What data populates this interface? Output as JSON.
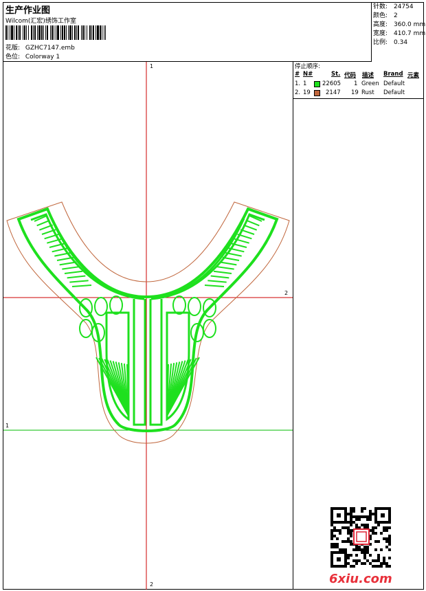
{
  "header": {
    "title": "生产作业图",
    "company": "Wilcom(汇宏)绣饰工作室",
    "design_label": "花版:",
    "design_value": "GZHC7147.emb",
    "colorway_label": "色位:",
    "colorway_value": "Colorway 1"
  },
  "stats": [
    {
      "label": "针数:",
      "value": "24754"
    },
    {
      "label": "颜色:",
      "value": "2"
    },
    {
      "label": "高度:",
      "value": "360.0 mm"
    },
    {
      "label": "宽度:",
      "value": "410.7 mm"
    },
    {
      "label": "比例:",
      "value": "0.34"
    }
  ],
  "color_sequence": {
    "title": "停止顺序:",
    "columns": [
      "#",
      "N#",
      "St.",
      "代码",
      "描述",
      "Brand",
      "元素"
    ],
    "rows": [
      {
        "index": "1.",
        "n": "1",
        "color": "#1ee01e",
        "stitches": "22605",
        "code": "1",
        "description": "Green",
        "brand": "Default"
      },
      {
        "index": "2.",
        "n": "19",
        "color": "#c0663c",
        "stitches": "2147",
        "code": "19",
        "description": "Rust",
        "brand": "Default"
      }
    ]
  },
  "axes": {
    "v_top": "1",
    "v_bottom": "2",
    "h_upper_right": "2",
    "h_lower_left": "1"
  },
  "watermark": "6xiu.com",
  "colors": {
    "green": "#1ee01e",
    "rust": "#c0663c",
    "guide_red": "#cc0000",
    "guide_green": "#00bb00"
  }
}
